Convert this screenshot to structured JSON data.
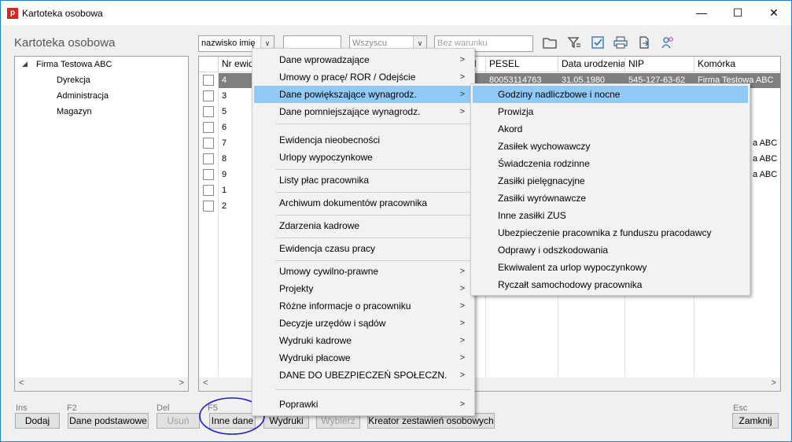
{
  "window": {
    "app_icon_letter": "p",
    "title": "Kartoteka osobowa",
    "minimize": "—",
    "maximize": "☐",
    "close": "✕"
  },
  "header": {
    "page_title": "Kartoteka osobowa",
    "sort_field_value": "nazwisko imię",
    "search_value": "",
    "filter_value": "Wszyscu",
    "condition_placeholder": "Bez warunku",
    "combo_arrow": "∨"
  },
  "toolbar_icons": [
    "folder-icon",
    "filter-icon",
    "checkbox-icon",
    "print-icon",
    "export-icon",
    "users-icon"
  ],
  "tree": {
    "root": {
      "toggle": "◢",
      "label": "Firma Testowa ABC"
    },
    "children": [
      "Dyrekcja",
      "Administracja",
      "Magazyn"
    ]
  },
  "grid": {
    "columns": {
      "nr": "Nr ewid",
      "n": "N",
      "pesel": "PESEL",
      "dob": "Data urodzenia",
      "nip": "NIP",
      "dept": "Komórka"
    },
    "rows": [
      {
        "nr": "4",
        "pesel": "80053114763",
        "dob": "31.05.1980",
        "nip": "545-127-63-62",
        "dept": "Firma Testowa ABC",
        "selected": true
      },
      {
        "nr": "3",
        "dept": ""
      },
      {
        "nr": "5",
        "dept": ""
      },
      {
        "nr": "6",
        "dept": ""
      },
      {
        "nr": "7",
        "dept": "a ABC"
      },
      {
        "nr": "8",
        "dept": "a ABC"
      },
      {
        "nr": "9",
        "dept": "a ABC"
      },
      {
        "nr": "1",
        "dept": ""
      },
      {
        "nr": "2",
        "dept": ""
      }
    ],
    "scroll_left": "<",
    "scroll_right": ">"
  },
  "context_menu": {
    "items": [
      {
        "label": "Dane wprowadzające",
        "arrow": ">"
      },
      {
        "label": "Umowy o pracę/ ROR / Odejście",
        "arrow": ">"
      },
      {
        "label": "Dane powiększające wynagrodz.",
        "arrow": ">",
        "highlighted": true
      },
      {
        "label": "Dane pomniejszające wynagrodz.",
        "arrow": ">"
      },
      {
        "label": "Ewidencja nieobecności"
      },
      {
        "label": "Urlopy wypoczynkowe"
      },
      {
        "label": "Listy płac pracownika"
      },
      {
        "label": "Archiwum dokumentów pracownika"
      },
      {
        "label": "Zdarzenia kadrowe"
      },
      {
        "label": "Ewidencja czasu pracy"
      },
      {
        "label": "Umowy cywilno-prawne",
        "arrow": ">"
      },
      {
        "label": "Projekty",
        "arrow": ">"
      },
      {
        "label": "Różne informacje o pracowniku",
        "arrow": ">"
      },
      {
        "label": "Decyzje urzędów i sądów",
        "arrow": ">"
      },
      {
        "label": "Wydruki kadrowe",
        "arrow": ">"
      },
      {
        "label": "Wydruki płacowe",
        "arrow": ">"
      },
      {
        "label": "DANE DO UBEZPIECZEŃ SPOŁECZN.",
        "arrow": ">"
      },
      {
        "label": "Poprawki",
        "arrow": ">"
      }
    ]
  },
  "submenu": {
    "items": [
      "Godziny nadliczbowe i nocne",
      "Prowizja",
      "Akord",
      "Zasiłek wychowawczy",
      "Świadczenia rodzinne",
      "Zasiłki pielęgnacyjne",
      "Zasiłki wyrównawcze",
      "Inne zasiłki ZUS",
      "Ubezpieczenie pracownika z funduszu pracodawcy",
      "Odprawy i odszkodowania",
      "Ekwiwalent za urlop wypoczynkowy",
      "Ryczałt samochodowy pracownika"
    ],
    "highlighted_index": 0
  },
  "bottom": {
    "fkeys": {
      "ins": "Ins",
      "f2": "F2",
      "del": "Del",
      "f5": "F5",
      "esc": "Esc"
    },
    "buttons": {
      "dodaj": "Dodaj",
      "dane_podstawowe": "Dane podstawowe",
      "usun": "Usuń",
      "inne_dane": "Inne dane",
      "wydruki": "Wydruki",
      "wybierz": "Wybierz",
      "kreator": "Kreator zestawień osobowych",
      "zamknij": "Zamknij"
    }
  },
  "colors": {
    "title_accent": "#1883d7",
    "selected_row": "#7f7f7f",
    "menu_highlight": "#91c9f7",
    "annotation_circle": "#1a1acb"
  }
}
